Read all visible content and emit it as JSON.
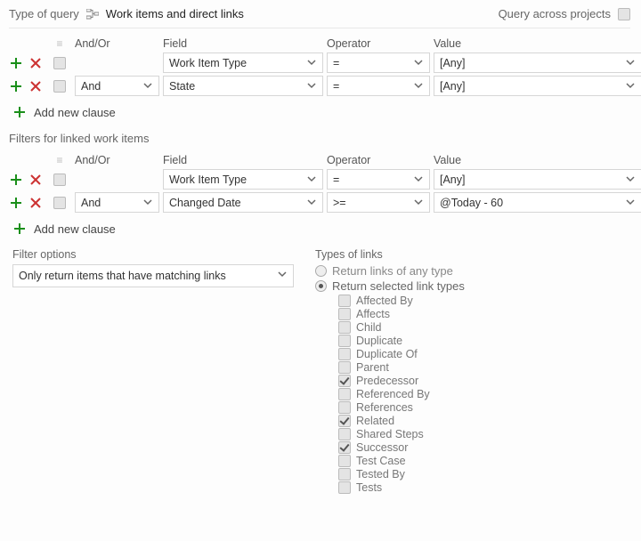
{
  "header": {
    "type_of_query_label": "Type of query",
    "query_type_name": "Work items and direct links",
    "cross_projects_label": "Query across projects",
    "cross_projects_checked": false
  },
  "columns": {
    "andor": "And/Or",
    "field": "Field",
    "operator": "Operator",
    "value": "Value"
  },
  "main_filters": [
    {
      "andor": "",
      "field": "Work Item Type",
      "operator": "=",
      "value": "[Any]"
    },
    {
      "andor": "And",
      "field": "State",
      "operator": "=",
      "value": "[Any]"
    }
  ],
  "linked_section_title": "Filters for linked work items",
  "linked_filters": [
    {
      "andor": "",
      "field": "Work Item Type",
      "operator": "=",
      "value": "[Any]"
    },
    {
      "andor": "And",
      "field": "Changed Date",
      "operator": ">=",
      "value": "@Today - 60"
    }
  ],
  "add_clause_label": "Add new clause",
  "filter_options": {
    "label": "Filter options",
    "value": "Only return items that have matching links"
  },
  "link_types": {
    "label": "Types of links",
    "any": "Return links of any type",
    "selected": "Return selected link types",
    "mode": "selected",
    "items": [
      {
        "label": "Affected By",
        "checked": false
      },
      {
        "label": "Affects",
        "checked": false
      },
      {
        "label": "Child",
        "checked": false
      },
      {
        "label": "Duplicate",
        "checked": false
      },
      {
        "label": "Duplicate Of",
        "checked": false
      },
      {
        "label": "Parent",
        "checked": false
      },
      {
        "label": "Predecessor",
        "checked": true
      },
      {
        "label": "Referenced By",
        "checked": false
      },
      {
        "label": "References",
        "checked": false
      },
      {
        "label": "Related",
        "checked": true
      },
      {
        "label": "Shared Steps",
        "checked": false
      },
      {
        "label": "Successor",
        "checked": true
      },
      {
        "label": "Test Case",
        "checked": false
      },
      {
        "label": "Tested By",
        "checked": false
      },
      {
        "label": "Tests",
        "checked": false
      }
    ]
  }
}
